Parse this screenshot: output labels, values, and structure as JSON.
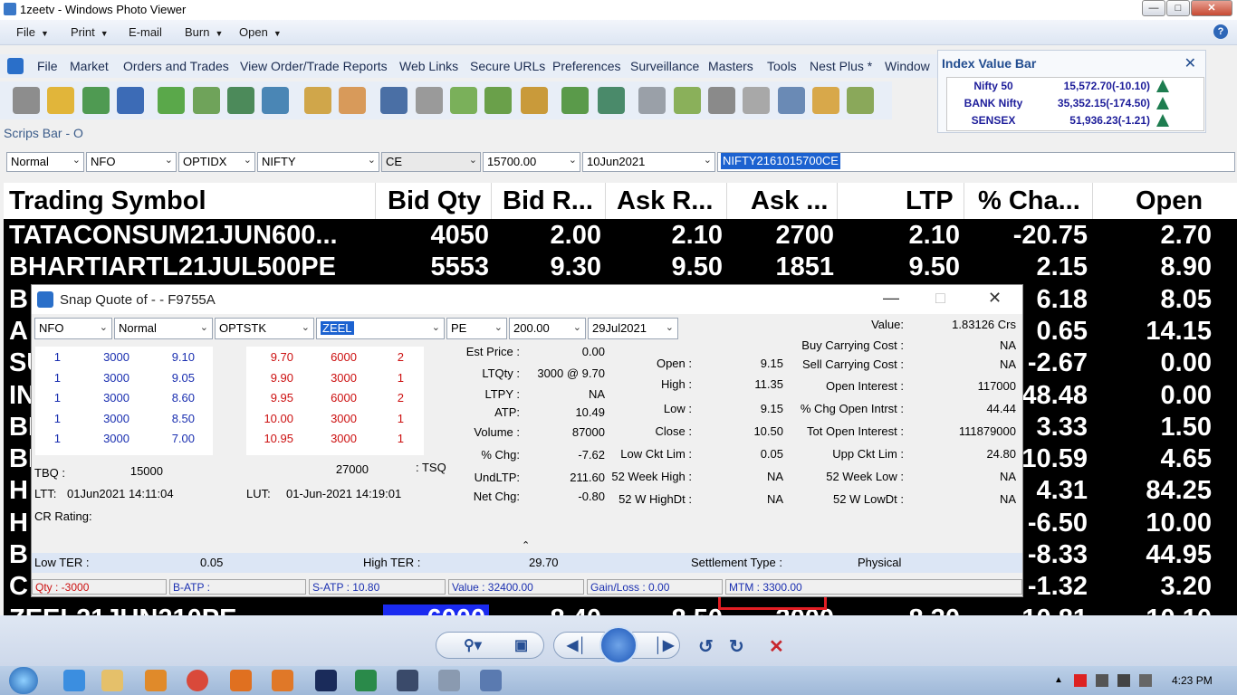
{
  "viewer": {
    "title": "1zeetv - Windows Photo Viewer",
    "menu": [
      "File",
      "Print",
      "E-mail",
      "Burn",
      "Open"
    ],
    "help": "?"
  },
  "app_menu": [
    "File",
    "Market",
    "Orders and Trades",
    "View Order/Trade Reports",
    "Web Links",
    "Secure URLs",
    "Preferences",
    "Surveillance",
    "Masters",
    "Tools",
    "Nest Plus *",
    "Window"
  ],
  "scrips_bar": {
    "title": "Scrips Bar - O",
    "fields": [
      "Normal",
      "NFO",
      "OPTIDX",
      "NIFTY",
      "CE",
      "15700.00",
      "10Jun2021"
    ],
    "symbol": "NIFTY2161015700CE"
  },
  "index_bar": {
    "title": "Index Value Bar",
    "rows": [
      {
        "name": "Nifty 50",
        "value": "15,572.70(-10.10)"
      },
      {
        "name": "BANK Nifty",
        "value": "35,352.15(-174.50)"
      },
      {
        "name": "SENSEX",
        "value": "51,936.23(-1.21)"
      }
    ]
  },
  "market_watch": {
    "headers": [
      "Trading Symbol",
      "Bid Qty",
      "Bid R...",
      "Ask R...",
      "Ask ...",
      "LTP",
      "% Cha...",
      "Open"
    ],
    "rows": [
      [
        "TATACONSUM21JUN600...",
        "4050",
        "2.00",
        "2.10",
        "2700",
        "2.10",
        "-20.75",
        "2.70"
      ],
      [
        "BHARTIARTL21JUL500PE",
        "5553",
        "9.30",
        "9.50",
        "1851",
        "9.50",
        "2.15",
        "8.90"
      ],
      [
        "B",
        "",
        "",
        "",
        "",
        "",
        "6.18",
        "8.05"
      ],
      [
        "A",
        "",
        "",
        "",
        "",
        "",
        "0.65",
        "14.15"
      ],
      [
        "SU",
        "",
        "",
        "",
        "",
        "",
        "-2.67",
        "0.00"
      ],
      [
        "IN",
        "",
        "",
        "",
        "",
        "",
        "48.48",
        "0.00"
      ],
      [
        "BI",
        "",
        "",
        "",
        "",
        "",
        "3.33",
        "1.50"
      ],
      [
        "BI",
        "",
        "",
        "",
        "",
        "",
        "10.59",
        "4.65"
      ],
      [
        "H",
        "",
        "",
        "",
        "",
        "",
        "4.31",
        "84.25"
      ],
      [
        "H",
        "",
        "",
        "",
        "",
        "",
        "-6.50",
        "10.00"
      ],
      [
        "B",
        "",
        "",
        "",
        "",
        "",
        "-8.33",
        "44.95"
      ],
      [
        "C",
        "",
        "",
        "",
        "",
        "",
        "-1.32",
        "3.20"
      ],
      [
        "ZEEL21JUN210PE",
        "6000",
        "8.40",
        "8.50",
        "3000",
        "8.30",
        "10.81",
        "10.10"
      ]
    ]
  },
  "snap_quote": {
    "title": "Snap Quote of  -  - F9755A",
    "fields": [
      "NFO",
      "Normal",
      "OPTSTK",
      "ZEEL",
      "PE",
      "200.00",
      "29Jul2021"
    ],
    "bids": [
      [
        "1",
        "3000",
        "9.10"
      ],
      [
        "1",
        "3000",
        "9.05"
      ],
      [
        "1",
        "3000",
        "8.60"
      ],
      [
        "1",
        "3000",
        "8.50"
      ],
      [
        "1",
        "3000",
        "7.00"
      ]
    ],
    "asks": [
      [
        "9.70",
        "6000",
        "2"
      ],
      [
        "9.90",
        "3000",
        "1"
      ],
      [
        "9.95",
        "6000",
        "2"
      ],
      [
        "10.00",
        "3000",
        "1"
      ],
      [
        "10.95",
        "3000",
        "1"
      ]
    ],
    "tbq_label": "TBQ :",
    "tbq": "15000",
    "tsq": "27000",
    "tsq_label": ": TSQ",
    "ltt_label": "LTT:",
    "ltt": "01Jun2021 14:11:04",
    "lut_label": "LUT:",
    "lut": "01-Jun-2021 14:19:01",
    "cr_rating": "CR Rating:",
    "col1": [
      {
        "label": "Est Price :",
        "value": "0.00"
      },
      {
        "label": "LTQty :",
        "value": "3000 @ 9.70"
      },
      {
        "label": "LTPY :",
        "value": "NA"
      },
      {
        "label": "ATP:",
        "value": "10.49"
      },
      {
        "label": "Volume :",
        "value": "87000"
      },
      {
        "label": "% Chg:",
        "value": "-7.62"
      },
      {
        "label": "UndLTP:",
        "value": "211.60"
      },
      {
        "label": "Net Chg:",
        "value": "-0.80"
      }
    ],
    "col2": [
      {
        "label": "Open :",
        "value": "9.15"
      },
      {
        "label": "High :",
        "value": "11.35"
      },
      {
        "label": "Low :",
        "value": "9.15"
      },
      {
        "label": "Close :",
        "value": "10.50"
      },
      {
        "label": "Low Ckt Lim :",
        "value": "0.05"
      },
      {
        "label": "52 Week High :",
        "value": "NA"
      },
      {
        "label": "52 W HighDt :",
        "value": "NA"
      }
    ],
    "col3": [
      {
        "label": "Value:",
        "value": "1.83126 Crs"
      },
      {
        "label": "Buy Carrying Cost :",
        "value": "NA"
      },
      {
        "label": "Sell Carrying Cost :",
        "value": "NA"
      },
      {
        "label": "Open Interest :",
        "value": "117000"
      },
      {
        "label": "% Chg Open Intrst :",
        "value": "44.44"
      },
      {
        "label": "Tot Open Interest :",
        "value": "111879000"
      },
      {
        "label": "Upp Ckt Lim :",
        "value": "24.80"
      },
      {
        "label": "52 Week Low :",
        "value": "NA"
      },
      {
        "label": "52 W LowDt :",
        "value": "NA"
      }
    ],
    "ter": {
      "low_label": "Low TER :",
      "low": "0.05",
      "high_label": "High TER :",
      "high": "29.70",
      "settle_label": "Settlement Type :",
      "settle": "Physical"
    },
    "status": [
      "Qty : -3000",
      "B-ATP :",
      "S-ATP : 10.80",
      "Value : 32400.00",
      "Gain/Loss : 0.00",
      "MTM : 3300.00"
    ]
  },
  "taskbar": {
    "time": "4:23 PM"
  },
  "colors": {
    "bid_blue": "#1a2fb0",
    "ask_red": "#cc1010",
    "highlight": "#e31e24"
  }
}
